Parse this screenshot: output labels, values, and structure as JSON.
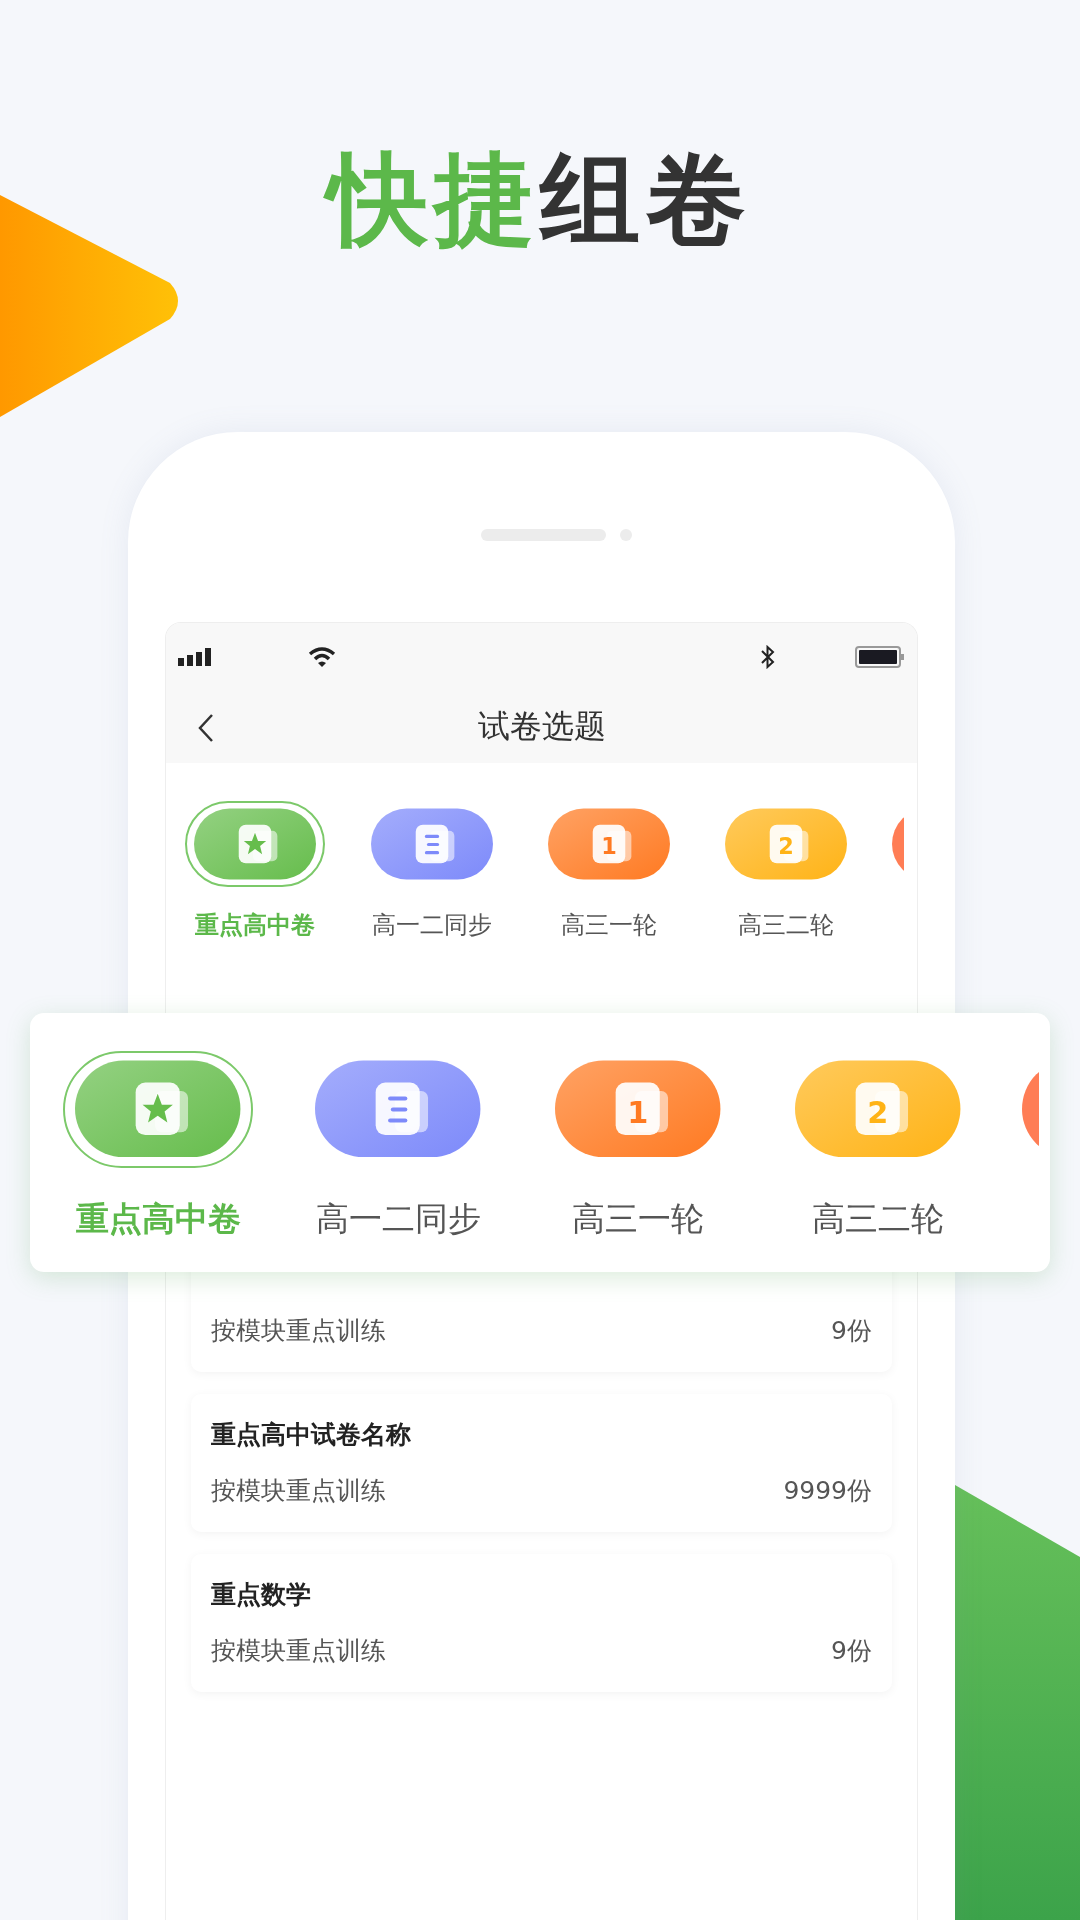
{
  "headline": {
    "accent": "快捷",
    "text": "组卷"
  },
  "screen": {
    "title": "试卷选题",
    "categories": [
      {
        "label": "重点高中卷",
        "kind": "star",
        "color": "#66bd4c",
        "selected": true
      },
      {
        "label": "高一二同步",
        "kind": "lines",
        "color": "#7d8afa",
        "selected": false
      },
      {
        "label": "高三一轮",
        "kind": "digit",
        "badge": "1",
        "color": "#ff7a22",
        "selected": false
      },
      {
        "label": "高三二轮",
        "kind": "digit",
        "badge": "2",
        "color": "#ffb316",
        "selected": false
      },
      {
        "kind": "blank",
        "color": "#ff7d55",
        "selected": false
      }
    ],
    "papers": [
      {
        "subtitle": "按模块重点训练",
        "count": "9份"
      },
      {
        "title": "重点高中试卷名称",
        "subtitle": "按模块重点训练",
        "count": "9999份"
      },
      {
        "title": "重点数学",
        "subtitle": "按模块重点训练",
        "count": "9份"
      }
    ]
  },
  "popup": {
    "categories": [
      {
        "label": "重点高中卷",
        "kind": "star",
        "color": "#66bd4c",
        "selected": true
      },
      {
        "label": "高一二同步",
        "kind": "lines",
        "color": "#7d8afa",
        "selected": false
      },
      {
        "label": "高三一轮",
        "kind": "digit",
        "badge": "1",
        "color": "#ff7a22",
        "selected": false
      },
      {
        "label": "高三二轮",
        "kind": "digit",
        "badge": "2",
        "color": "#ffb316",
        "selected": false
      },
      {
        "kind": "blank",
        "color": "#ff7d55",
        "selected": false
      }
    ]
  }
}
